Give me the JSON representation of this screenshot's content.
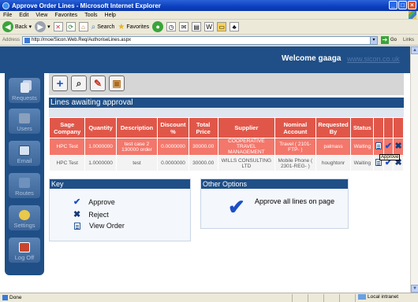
{
  "window": {
    "title": "Approve Order Lines - Microsoft Internet Explorer",
    "menu": [
      "File",
      "Edit",
      "View",
      "Favorites",
      "Tools",
      "Help"
    ]
  },
  "toolbar": {
    "back": "Back",
    "search": "Search",
    "favorites": "Favorites"
  },
  "address": {
    "label": "Address",
    "url": "http://rnoe/Sicon.Web.Req/AuthoriseLines.aspx",
    "go": "Go",
    "links": "Links"
  },
  "header": {
    "welcome": "Welcome gaaga",
    "site_link": "www.sicon.co.uk"
  },
  "sidebar": {
    "items": [
      {
        "label": "Requests",
        "icon": "requests-icon"
      },
      {
        "label": "Users",
        "icon": "users-icon"
      },
      {
        "label": "Email",
        "icon": "email-icon"
      },
      {
        "label": "Routes",
        "icon": "routes-icon"
      },
      {
        "label": "Settings",
        "icon": "settings-icon"
      },
      {
        "label": "Log Off",
        "icon": "log-off-icon"
      }
    ]
  },
  "main": {
    "section_title": "Lines awaiting approval",
    "columns": [
      "Sage Company",
      "Quantity",
      "Description",
      "Discount %",
      "Total Price",
      "Supplier",
      "Nominal Account",
      "Requested By",
      "Status"
    ],
    "rows": [
      {
        "company": "HPC Test",
        "quantity": "1.0000000",
        "description": "test case 2 130000 order",
        "discount": "0.0000000",
        "total": "30000.00",
        "supplier": "COOPERATIVE TRAVEL MANAGEMENT",
        "nominal": "Travel ( 2101-FTP- )",
        "requested_by": "palmass",
        "status": "Waiting"
      },
      {
        "company": "HPC Test",
        "quantity": "1.0000000",
        "description": "test",
        "discount": "0.0000000",
        "total": "30000.00",
        "supplier": "WILLS CONSULTING LTD",
        "nominal": "Mobile Phone ( 2301-REG- )",
        "requested_by": "houghtonr",
        "status": "Waiting"
      }
    ],
    "tooltip": "Approve"
  },
  "key_panel": {
    "title": "Key",
    "items": [
      "Approve",
      "Reject",
      "View Order"
    ]
  },
  "other_panel": {
    "title": "Other Options",
    "approve_all": "Approve all lines on page"
  },
  "status": {
    "text": "Done",
    "zone": "Local intranet"
  },
  "colors": {
    "brand_blue": "#1f4f86",
    "header_red": "#e05749",
    "selected_row": "#f3776b"
  }
}
